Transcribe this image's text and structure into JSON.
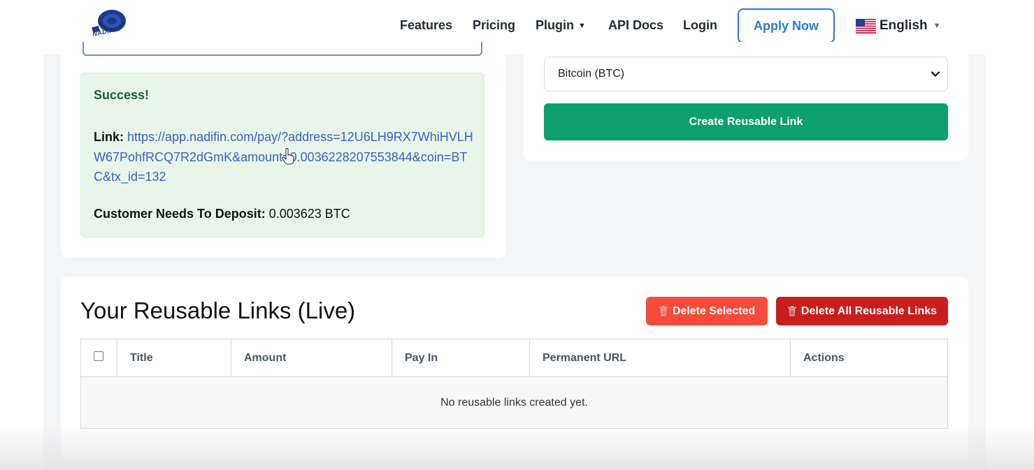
{
  "header": {
    "logo_text": "NADIFIN",
    "nav": {
      "features": "Features",
      "pricing": "Pricing",
      "plugin": "Plugin",
      "api_docs": "API Docs",
      "login": "Login"
    },
    "apply_label": "Apply Now",
    "language": "English"
  },
  "success": {
    "title": "Success!",
    "link_label": "Link:",
    "link_url": "https://app.nadifin.com/pay/?address=12U6LH9RX7WhiHVLHW67PohfRCQ7R2dGmK&amount=0.0036228207553844&coin=BTC&tx_id=132",
    "deposit_label": "Customer Needs To Deposit:",
    "deposit_value": "0.003623 BTC"
  },
  "form": {
    "coin_selected": "Bitcoin (BTC)",
    "create_label": "Create Reusable Link"
  },
  "links": {
    "title": "Your Reusable Links (Live)",
    "delete_selected_label": "Delete Selected",
    "delete_all_label": "Delete All Reusable Links",
    "columns": [
      "Title",
      "Amount",
      "Pay In",
      "Permanent URL",
      "Actions"
    ],
    "empty_message": "No reusable links created yet."
  },
  "colors": {
    "accent_blue": "#2f76d3",
    "create_green": "#0e9f6e",
    "delete_selected_red": "#f44b3a",
    "delete_all_red": "#c81e1e",
    "success_bg": "#e8f6ea"
  },
  "icons": {
    "logo": "nadifin-logo",
    "flag": "us-flag-icon",
    "trash": "trash-icon",
    "select": "chevron-down-icon"
  }
}
